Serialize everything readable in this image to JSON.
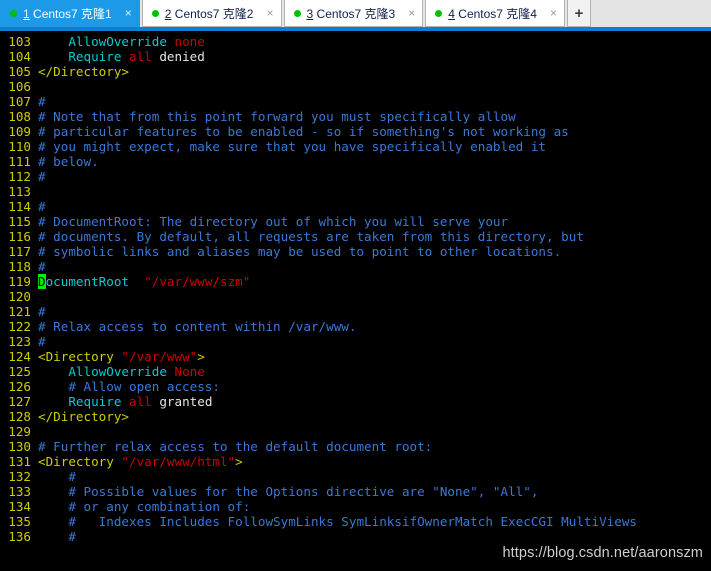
{
  "tabbar": {
    "new_tab_label": "+",
    "close_label": "×",
    "status_dot_color": "#00c000",
    "active_tab_bg": "#1c9ae8",
    "accent_underline": "#0a7fd4",
    "tabs": [
      {
        "number": "1",
        "title": "Centos7 克隆",
        "suffix": "1",
        "active": true
      },
      {
        "number": "2",
        "title": "Centos7 克隆",
        "suffix": "2",
        "active": false
      },
      {
        "number": "3",
        "title": "Centos7 克隆",
        "suffix": "3",
        "active": false
      },
      {
        "number": "4",
        "title": "Centos7 克隆",
        "suffix": "4",
        "active": false
      }
    ]
  },
  "terminal": {
    "background": "#000000",
    "line_number_color": "#cdcd00",
    "comment_color": "#3a78d6",
    "string_color": "#cd0000",
    "keyword_color": "#00cdcd",
    "tag_color": "#cdcd00",
    "plain_color": "#e5e5e5",
    "cursor_color": "#00ee00",
    "cursor_line": "119",
    "cursor_char": "D",
    "lines": [
      {
        "n": "103",
        "parts": [
          {
            "t": "    ",
            "c": "plain"
          },
          {
            "t": "AllowOverride",
            "c": "key"
          },
          {
            "t": " ",
            "c": "plain"
          },
          {
            "t": "none",
            "c": "val"
          }
        ]
      },
      {
        "n": "104",
        "parts": [
          {
            "t": "    ",
            "c": "plain"
          },
          {
            "t": "Require",
            "c": "key"
          },
          {
            "t": " ",
            "c": "plain"
          },
          {
            "t": "all",
            "c": "val"
          },
          {
            "t": " denied",
            "c": "plain"
          }
        ]
      },
      {
        "n": "105",
        "parts": [
          {
            "t": "</Directory>",
            "c": "tag"
          }
        ]
      },
      {
        "n": "106",
        "parts": []
      },
      {
        "n": "107",
        "parts": [
          {
            "t": "#",
            "c": "comment"
          }
        ]
      },
      {
        "n": "108",
        "parts": [
          {
            "t": "# Note that from this point forward you must specifically allow",
            "c": "comment"
          }
        ]
      },
      {
        "n": "109",
        "parts": [
          {
            "t": "# particular features to be enabled - so if something's not working as",
            "c": "comment"
          }
        ]
      },
      {
        "n": "110",
        "parts": [
          {
            "t": "# you might expect, make sure that you have specifically enabled it",
            "c": "comment"
          }
        ]
      },
      {
        "n": "111",
        "parts": [
          {
            "t": "# below.",
            "c": "comment"
          }
        ]
      },
      {
        "n": "112",
        "parts": [
          {
            "t": "#",
            "c": "comment"
          }
        ]
      },
      {
        "n": "113",
        "parts": []
      },
      {
        "n": "114",
        "parts": [
          {
            "t": "#",
            "c": "comment"
          }
        ]
      },
      {
        "n": "115",
        "parts": [
          {
            "t": "# DocumentRoot: The directory out of which you will serve your",
            "c": "comment"
          }
        ]
      },
      {
        "n": "116",
        "parts": [
          {
            "t": "# documents. By default, all requests are taken from this directory, but",
            "c": "comment"
          }
        ]
      },
      {
        "n": "117",
        "parts": [
          {
            "t": "# symbolic links and aliases may be used to point to other locations.",
            "c": "comment"
          }
        ]
      },
      {
        "n": "118",
        "parts": [
          {
            "t": "#",
            "c": "comment"
          }
        ]
      },
      {
        "n": "119",
        "parts": [
          {
            "t": "D",
            "c": "cursor"
          },
          {
            "t": "ocumentRoot",
            "c": "key"
          },
          {
            "t": "  ",
            "c": "plain"
          },
          {
            "t": "\"/var/www/szm\"",
            "c": "str"
          }
        ]
      },
      {
        "n": "120",
        "parts": []
      },
      {
        "n": "121",
        "parts": [
          {
            "t": "#",
            "c": "comment"
          }
        ]
      },
      {
        "n": "122",
        "parts": [
          {
            "t": "# Relax access to content within /var/www.",
            "c": "comment"
          }
        ]
      },
      {
        "n": "123",
        "parts": [
          {
            "t": "#",
            "c": "comment"
          }
        ]
      },
      {
        "n": "124",
        "parts": [
          {
            "t": "<Directory ",
            "c": "tag"
          },
          {
            "t": "\"/var/www\"",
            "c": "str"
          },
          {
            "t": ">",
            "c": "tag"
          }
        ]
      },
      {
        "n": "125",
        "parts": [
          {
            "t": "    ",
            "c": "plain"
          },
          {
            "t": "AllowOverride",
            "c": "key"
          },
          {
            "t": " ",
            "c": "plain"
          },
          {
            "t": "None",
            "c": "val"
          }
        ]
      },
      {
        "n": "126",
        "parts": [
          {
            "t": "    # Allow open access:",
            "c": "comment"
          }
        ]
      },
      {
        "n": "127",
        "parts": [
          {
            "t": "    ",
            "c": "plain"
          },
          {
            "t": "Require",
            "c": "key"
          },
          {
            "t": " ",
            "c": "plain"
          },
          {
            "t": "all",
            "c": "val"
          },
          {
            "t": " granted",
            "c": "plain"
          }
        ]
      },
      {
        "n": "128",
        "parts": [
          {
            "t": "</Directory>",
            "c": "tag"
          }
        ]
      },
      {
        "n": "129",
        "parts": []
      },
      {
        "n": "130",
        "parts": [
          {
            "t": "# Further relax access to the default document root:",
            "c": "comment"
          }
        ]
      },
      {
        "n": "131",
        "parts": [
          {
            "t": "<Directory ",
            "c": "tag"
          },
          {
            "t": "\"/var/www/html\"",
            "c": "str"
          },
          {
            "t": ">",
            "c": "tag"
          }
        ]
      },
      {
        "n": "132",
        "parts": [
          {
            "t": "    #",
            "c": "comment"
          }
        ]
      },
      {
        "n": "133",
        "parts": [
          {
            "t": "    # Possible values for the Options directive are \"None\", \"All\",",
            "c": "comment"
          }
        ]
      },
      {
        "n": "134",
        "parts": [
          {
            "t": "    # or any combination of:",
            "c": "comment"
          }
        ]
      },
      {
        "n": "135",
        "parts": [
          {
            "t": "    #   Indexes Includes FollowSymLinks SymLinksifOwnerMatch ExecCGI MultiViews",
            "c": "comment"
          }
        ]
      },
      {
        "n": "136",
        "parts": [
          {
            "t": "    #",
            "c": "comment"
          }
        ]
      }
    ]
  },
  "watermark": {
    "text": "https://blog.csdn.net/aaronszm"
  }
}
